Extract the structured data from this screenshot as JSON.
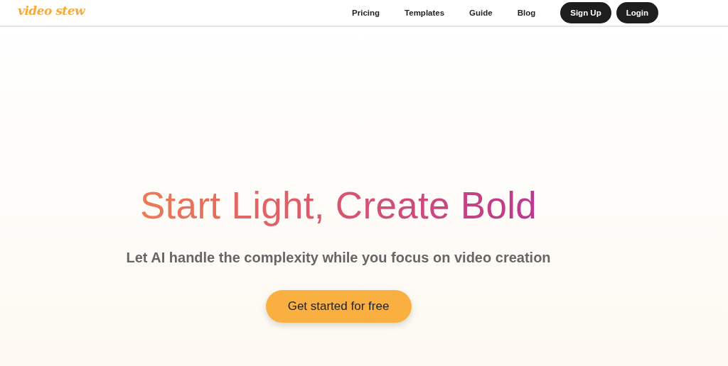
{
  "header": {
    "logo": "video stew",
    "nav": [
      {
        "label": "Pricing"
      },
      {
        "label": "Templates"
      },
      {
        "label": "Guide"
      },
      {
        "label": "Blog"
      }
    ],
    "buttons": [
      {
        "label": "Sign Up"
      },
      {
        "label": "Login"
      }
    ]
  },
  "hero": {
    "title": "Start Light, Create Bold",
    "subtitle": "Let AI handle the complexity while you focus on video creation",
    "cta": "Get started for free"
  }
}
